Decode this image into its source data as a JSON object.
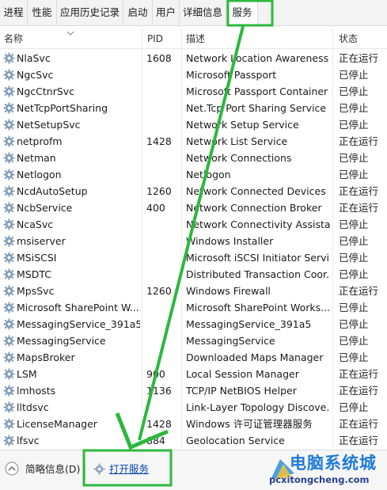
{
  "tabs": [
    {
      "label": "进程"
    },
    {
      "label": "性能"
    },
    {
      "label": "应用历史记录"
    },
    {
      "label": "启动"
    },
    {
      "label": "用户"
    },
    {
      "label": "详细信息"
    },
    {
      "label": "服务"
    }
  ],
  "columns": {
    "name": "名称",
    "pid": "PID",
    "desc": "描述",
    "status": "状态"
  },
  "rows": [
    {
      "name": "NlaSvc",
      "pid": "1608",
      "desc": "Network Location Awareness",
      "status": "正在运行"
    },
    {
      "name": "NgcSvc",
      "pid": "",
      "desc": "Microsoft Passport",
      "status": "已停止"
    },
    {
      "name": "NgcCtnrSvc",
      "pid": "",
      "desc": "Microsoft Passport Container",
      "status": "已停止"
    },
    {
      "name": "NetTcpPortSharing",
      "pid": "",
      "desc": "Net.Tcp Port Sharing Service",
      "status": "已停止"
    },
    {
      "name": "NetSetupSvc",
      "pid": "",
      "desc": "Network Setup Service",
      "status": "已停止"
    },
    {
      "name": "netprofm",
      "pid": "1428",
      "desc": "Network List Service",
      "status": "正在运行"
    },
    {
      "name": "Netman",
      "pid": "",
      "desc": "Network Connections",
      "status": "已停止"
    },
    {
      "name": "Netlogon",
      "pid": "",
      "desc": "Netlogon",
      "status": "已停止"
    },
    {
      "name": "NcdAutoSetup",
      "pid": "1260",
      "desc": "Network Connected Devices ...",
      "status": "正在运行"
    },
    {
      "name": "NcbService",
      "pid": "400",
      "desc": "Network Connection Broker",
      "status": "正在运行"
    },
    {
      "name": "NcaSvc",
      "pid": "",
      "desc": "Network Connectivity Assistant",
      "status": "已停止"
    },
    {
      "name": "msiserver",
      "pid": "",
      "desc": "Windows Installer",
      "status": "已停止"
    },
    {
      "name": "MSiSCSI",
      "pid": "",
      "desc": "Microsoft iSCSI Initiator Servi...",
      "status": "已停止"
    },
    {
      "name": "MSDTC",
      "pid": "",
      "desc": "Distributed Transaction Coor...",
      "status": "已停止"
    },
    {
      "name": "MpsSvc",
      "pid": "1260",
      "desc": "Windows Firewall",
      "status": "正在运行"
    },
    {
      "name": "Microsoft SharePoint W...",
      "pid": "",
      "desc": "Microsoft SharePoint Works...",
      "status": "已停止"
    },
    {
      "name": "MessagingService_391a5",
      "pid": "",
      "desc": "MessagingService_391a5",
      "status": "已停止"
    },
    {
      "name": "MessagingService",
      "pid": "",
      "desc": "MessagingService",
      "status": "已停止"
    },
    {
      "name": "MapsBroker",
      "pid": "",
      "desc": "Downloaded Maps Manager",
      "status": "已停止"
    },
    {
      "name": "LSM",
      "pid": "900",
      "desc": "Local Session Manager",
      "status": "正在运行"
    },
    {
      "name": "lmhosts",
      "pid": "1136",
      "desc": "TCP/IP NetBIOS Helper",
      "status": "正在运行"
    },
    {
      "name": "lltdsvc",
      "pid": "",
      "desc": "Link-Layer Topology Discove...",
      "status": "已停止"
    },
    {
      "name": "LicenseManager",
      "pid": "1428",
      "desc": "Windows 许可证管理器服务",
      "status": "正在运行"
    },
    {
      "name": "lfsvc",
      "pid": "884",
      "desc": "Geolocation Service",
      "status": "正在运行"
    }
  ],
  "footer": {
    "brief_label": "简略信息(D)",
    "open_services_label": "打开服务"
  },
  "watermark": {
    "title": "电脑系统城",
    "url": "pcxitongcheng.com"
  },
  "colors": {
    "annotation": "#2db83d",
    "link": "#0645ad",
    "watermark": "#1f7bd6"
  },
  "icons": {
    "service": "gear-icon",
    "collapse": "chevron-up-icon",
    "open_services": "gear-icon"
  }
}
